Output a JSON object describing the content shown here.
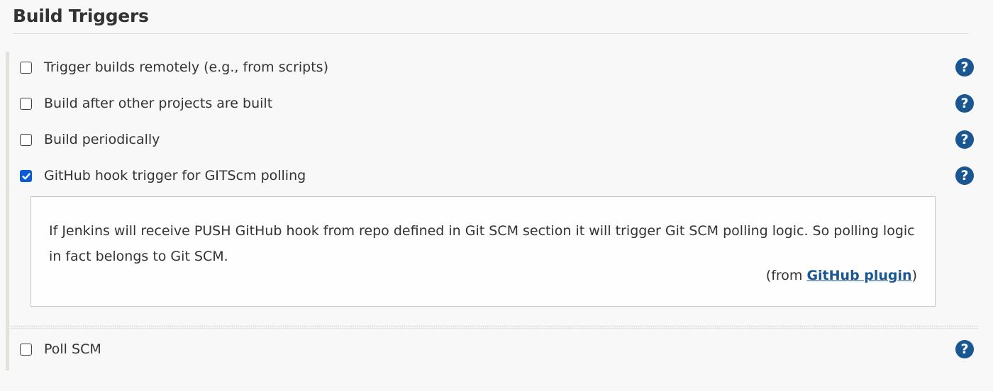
{
  "section": {
    "title": "Build Triggers"
  },
  "triggers": [
    {
      "label": "Trigger builds remotely (e.g., from scripts)",
      "checked": false,
      "help_icon": "question-circle-icon"
    },
    {
      "label": "Build after other projects are built",
      "checked": false,
      "help_icon": "question-circle-icon"
    },
    {
      "label": "Build periodically",
      "checked": false,
      "help_icon": "question-circle-icon"
    },
    {
      "label": "GitHub hook trigger for GITScm polling",
      "checked": true,
      "help_icon": "question-circle-icon"
    },
    {
      "label": "Poll SCM",
      "checked": false,
      "help_icon": "question-circle-icon"
    }
  ],
  "help_panel": {
    "text": "If Jenkins will receive PUSH GitHub hook from repo defined in Git SCM section it will trigger Git SCM polling logic. So polling logic in fact belongs to Git SCM.",
    "from_prefix": "(from ",
    "from_link": "GitHub plugin",
    "from_suffix": ")"
  },
  "help_icon_glyph": "?",
  "colors": {
    "checkbox_checked": "#0b5cd5",
    "help_icon": "#1a5692",
    "link": "#1a5692"
  }
}
